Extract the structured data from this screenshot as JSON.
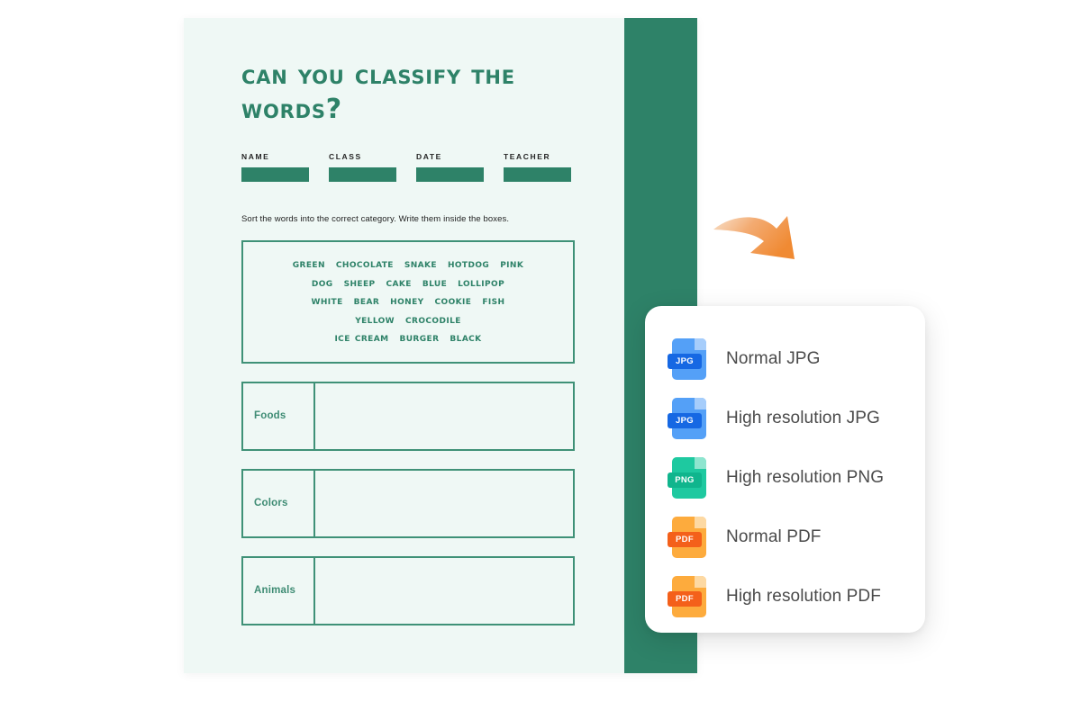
{
  "worksheet": {
    "title": "Can you classify the words?",
    "meta_fields": [
      {
        "label": "NAME"
      },
      {
        "label": "CLASS"
      },
      {
        "label": "DATE"
      },
      {
        "label": "TEACHER"
      }
    ],
    "instruction": "Sort the words into the correct category. Write them inside the boxes.",
    "word_bank": {
      "lines": [
        [
          "Green",
          "Chocolate",
          "Snake",
          "Hotdog",
          "Pink"
        ],
        [
          "Dog",
          "Sheep",
          "Cake",
          "Blue",
          "Lollipop"
        ],
        [
          "White",
          "Bear",
          "Honey",
          "Cookie",
          "Fish"
        ],
        [
          "Yellow",
          "Crocodile"
        ],
        [
          "Ice cream",
          "Burger",
          "Black"
        ]
      ]
    },
    "categories": [
      {
        "label": "Foods",
        "answer": ""
      },
      {
        "label": "Colors",
        "answer": ""
      },
      {
        "label": "Animals",
        "answer": ""
      }
    ],
    "colors": {
      "paper": "#eff8f5",
      "green": "#2e8268",
      "border_green": "#3f9177",
      "label_green": "#3f8c74"
    }
  },
  "arrow": {
    "icon": "curved-arrow-icon",
    "color_start": "#f5c9a0",
    "color_end": "#f08a33"
  },
  "download_menu": {
    "items": [
      {
        "label": "Normal JPG",
        "icon": "jpg-file-icon",
        "badge": "JPG",
        "body_color": "#54a0f7",
        "fold_color": "#a6cdfb",
        "badge_color": "#1668e3"
      },
      {
        "label": "High resolution JPG",
        "icon": "jpg-file-icon",
        "badge": "JPG",
        "body_color": "#54a0f7",
        "fold_color": "#a6cdfb",
        "badge_color": "#1668e3"
      },
      {
        "label": "High resolution PNG",
        "icon": "png-file-icon",
        "badge": "PNG",
        "body_color": "#1ec9a0",
        "fold_color": "#8ee5cf",
        "badge_color": "#10b58d"
      },
      {
        "label": "Normal PDF",
        "icon": "pdf-file-icon",
        "badge": "PDF",
        "body_color": "#fdab3d",
        "fold_color": "#fdd9a3",
        "badge_color": "#f4601a"
      },
      {
        "label": "High resolution PDF",
        "icon": "pdf-file-icon",
        "badge": "PDF",
        "body_color": "#fdab3d",
        "fold_color": "#fdd9a3",
        "badge_color": "#f4601a"
      }
    ]
  }
}
